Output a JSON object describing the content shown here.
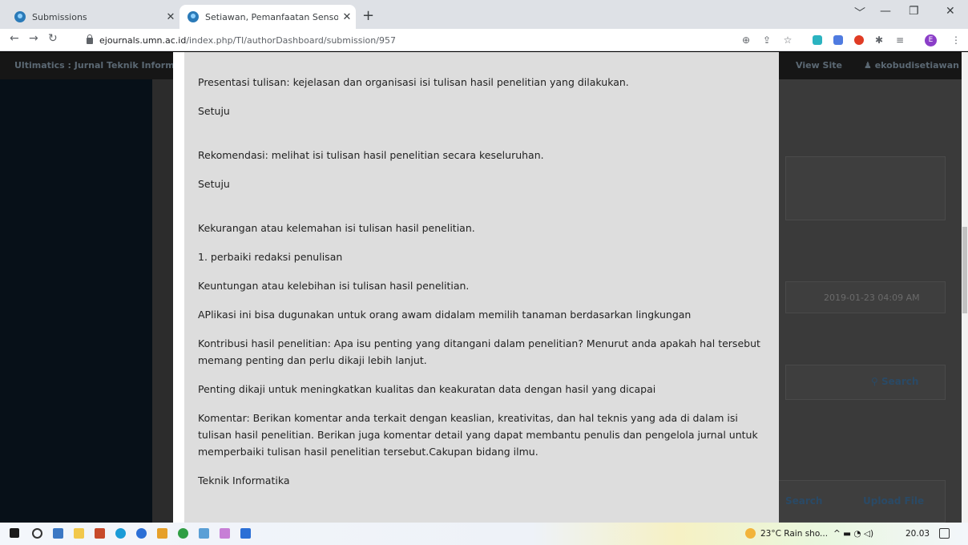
{
  "browser": {
    "tabs": [
      {
        "title": "Submissions",
        "active": false
      },
      {
        "title": "Setiawan, Pemanfaatan Sensor P...",
        "active": true
      }
    ],
    "new_tab_label": "+",
    "url_host": "ejournals.umn.ac.id",
    "url_path": "/index.php/TI/authorDashboard/submission/957",
    "profile_letter": "E",
    "window_controls": {
      "collapse": "﹀",
      "minimize": "—",
      "maximize": "❐",
      "close": "✕"
    }
  },
  "site": {
    "name": "Ultimatics : Jurnal Teknik Informatika",
    "view_site": "View Site",
    "user": "ekobudisetiawan"
  },
  "background": {
    "date": "2019-01-23 04:09 AM",
    "search_label": "Search",
    "search2_label": "Search",
    "upload_label": "Upload File"
  },
  "review": {
    "items": [
      "Presentasi tulisan: kejelasan dan organisasi isi tulisan hasil penelitian yang dilakukan.",
      "Setuju",
      "Rekomendasi: melihat isi tulisan hasil penelitian secara keseluruhan.",
      "Setuju",
      "Kekurangan atau kelemahan isi tulisan hasil penelitian.",
      "1. perbaiki redaksi penulisan",
      "Keuntungan atau kelebihan isi tulisan hasil penelitian.",
      "APlikasi ini bisa dugunakan untuk orang awam didalam memilih tanaman berdasarkan lingkungan",
      "Kontribusi hasil penelitian: Apa isu penting yang ditangani dalam penelitian? Menurut anda apakah hal tersebut memang penting dan perlu dikaji lebih lanjut.",
      "Penting dikaji untuk meningkatkan kualitas dan keakuratan data dengan hasil yang dicapai",
      "Komentar: Berikan komentar anda terkait dengan keaslian, kreativitas, dan hal teknis yang ada di dalam isi tulisan hasil penelitian. Berikan juga komentar detail yang dapat membantu penulis dan pengelola jurnal untuk memperbaiki tulisan hasil penelitian tersebut.Cakupan bidang ilmu.",
      "Teknik Informatika"
    ]
  },
  "taskbar": {
    "weather": "23°C  Rain sho...",
    "time": "20.03"
  },
  "colors": {
    "modal_bg": "#dddddd",
    "overlay": "#1a1a1a",
    "brand_link": "#2a4a66"
  }
}
